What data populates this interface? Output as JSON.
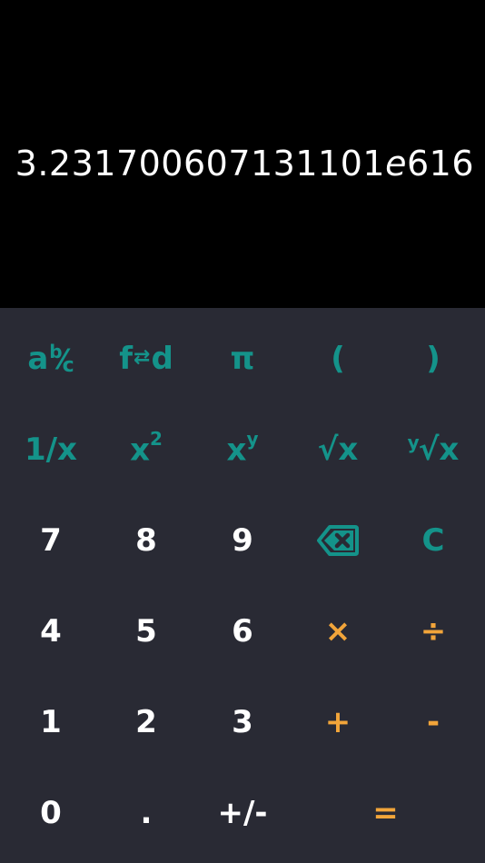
{
  "display": {
    "mantissa": "3.231700607131101",
    "exp_symbol": "e",
    "exponent": "616"
  },
  "keys": {
    "fraction": {
      "a": "a",
      "b": "b",
      "slash": "⁄",
      "c": "c"
    },
    "frac_dec": {
      "f": "f",
      "arrows": "⇄",
      "d": "d"
    },
    "pi": "π",
    "paren_open": "(",
    "paren_close": ")",
    "reciprocal": "1/x",
    "square": {
      "base": "x",
      "exp": "2"
    },
    "power": {
      "base": "x",
      "exp": "y"
    },
    "sqrt": "√x",
    "yroot": {
      "pre": "y",
      "body": "√x"
    },
    "seven": "7",
    "eight": "8",
    "nine": "9",
    "backspace_icon": "backspace-icon",
    "clear": "C",
    "four": "4",
    "five": "5",
    "six": "6",
    "multiply": "×",
    "divide": "÷",
    "one": "1",
    "two": "2",
    "three": "3",
    "plus": "+",
    "minus": "-",
    "zero": "0",
    "decimal": ".",
    "negate": "+/-",
    "equals": "="
  },
  "colors": {
    "display_bg": "#000000",
    "keypad_bg": "#292a34",
    "function_key": "#14938a",
    "number_key": "#ffffff",
    "operator_key": "#f2a53a"
  }
}
